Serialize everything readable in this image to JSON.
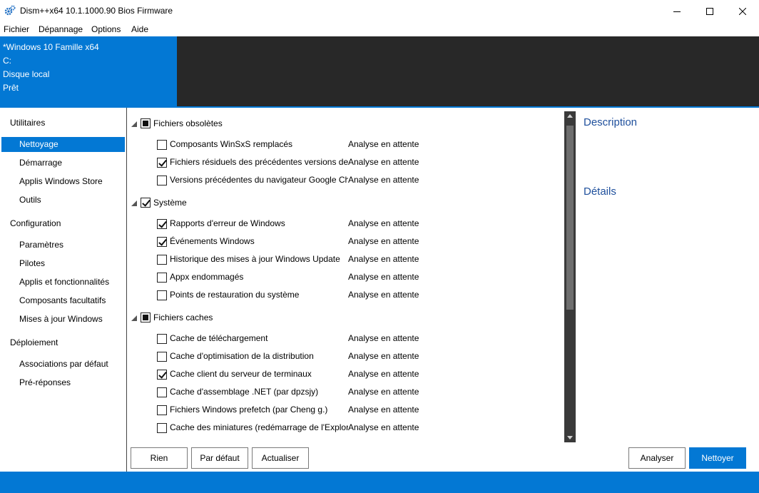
{
  "window": {
    "title": "Dism++x64 10.1.1000.90 Bios Firmware"
  },
  "menu": [
    "Fichier",
    "Dépannage",
    "Options",
    "Aide"
  ],
  "header": {
    "system": "*Windows 10 Famille x64",
    "drive": "C:",
    "disk": "Disque local",
    "status": "Prêt"
  },
  "sidebar": {
    "groups": [
      {
        "label": "Utilitaires",
        "items": [
          "Nettoyage",
          "Démarrage",
          "Applis Windows Store",
          "Outils"
        ]
      },
      {
        "label": "Configuration",
        "items": [
          "Paramètres",
          "Pilotes",
          "Applis et fonctionnalités",
          "Composants facultatifs",
          "Mises à jour Windows"
        ]
      },
      {
        "label": "Déploiement",
        "items": [
          "Associations par défaut",
          "Pré-réponses"
        ]
      }
    ],
    "active": "Nettoyage"
  },
  "cleanup": {
    "groups": [
      {
        "label": "Fichiers obsolètes",
        "state": "partial",
        "items": [
          {
            "label": "Composants WinSxS remplacés",
            "status": "Analyse en attente",
            "checked": false
          },
          {
            "label": "Fichiers résiduels des précédentes versions de D",
            "status": "Analyse en attente",
            "checked": true
          },
          {
            "label": "Versions précédentes du navigateur Google Chr",
            "status": "Analyse en attente",
            "checked": false
          }
        ]
      },
      {
        "label": "Système",
        "state": "checked",
        "items": [
          {
            "label": "Rapports d'erreur de Windows",
            "status": "Analyse en attente",
            "checked": true
          },
          {
            "label": "Événements Windows",
            "status": "Analyse en attente",
            "checked": true
          },
          {
            "label": "Historique des mises à jour Windows Update",
            "status": "Analyse en attente",
            "checked": false
          },
          {
            "label": "Appx endommagés",
            "status": "Analyse en attente",
            "checked": false
          },
          {
            "label": "Points de restauration du système",
            "status": "Analyse en attente",
            "checked": false
          }
        ]
      },
      {
        "label": "Fichiers caches",
        "state": "partial",
        "items": [
          {
            "label": "Cache de téléchargement",
            "status": "Analyse en attente",
            "checked": false
          },
          {
            "label": "Cache d'optimisation de la distribution",
            "status": "Analyse en attente",
            "checked": false
          },
          {
            "label": "Cache client du serveur de terminaux",
            "status": "Analyse en attente",
            "checked": true
          },
          {
            "label": "Cache d'assemblage .NET (par dpzsjy)",
            "status": "Analyse en attente",
            "checked": false
          },
          {
            "label": "Fichiers Windows prefetch (par Cheng g.)",
            "status": "Analyse en attente",
            "checked": false
          },
          {
            "label": "Cache des miniatures (redémarrage de l'Explora",
            "status": "Analyse en attente",
            "checked": false
          }
        ]
      }
    ]
  },
  "panel": {
    "description": "Description",
    "details": "Détails"
  },
  "buttons": {
    "rien": "Rien",
    "defaut": "Par défaut",
    "actualiser": "Actualiser",
    "analyser": "Analyser",
    "nettoyer": "Nettoyer"
  },
  "colors": {
    "accent": "#0378d4",
    "header_dark": "#282828",
    "section_title": "#1e4f9c"
  }
}
